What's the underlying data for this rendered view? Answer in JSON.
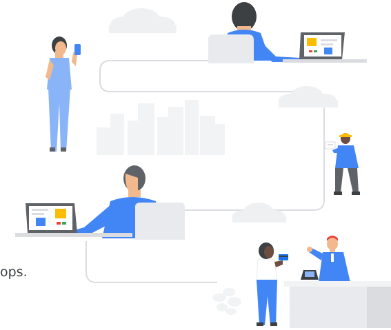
{
  "caption": {
    "text": "ops."
  },
  "colors": {
    "blue": "#4285f4",
    "blue_dark": "#1a73e8",
    "blue_light": "#8ab4f8",
    "skin": "#f2b98e",
    "skin_dark": "#6d4c41",
    "hair_dark": "#3c4043",
    "cloud": "#eef0f2",
    "city": "#f1f3f4",
    "path": "#dadce0",
    "yellow": "#fbbc04",
    "red": "#ea4335",
    "green": "#34a853"
  },
  "icons": [
    "phone-icon",
    "credit-card-icon",
    "payment-terminal-icon",
    "hard-hat-icon",
    "clipboard-icon",
    "laptop-icon"
  ]
}
